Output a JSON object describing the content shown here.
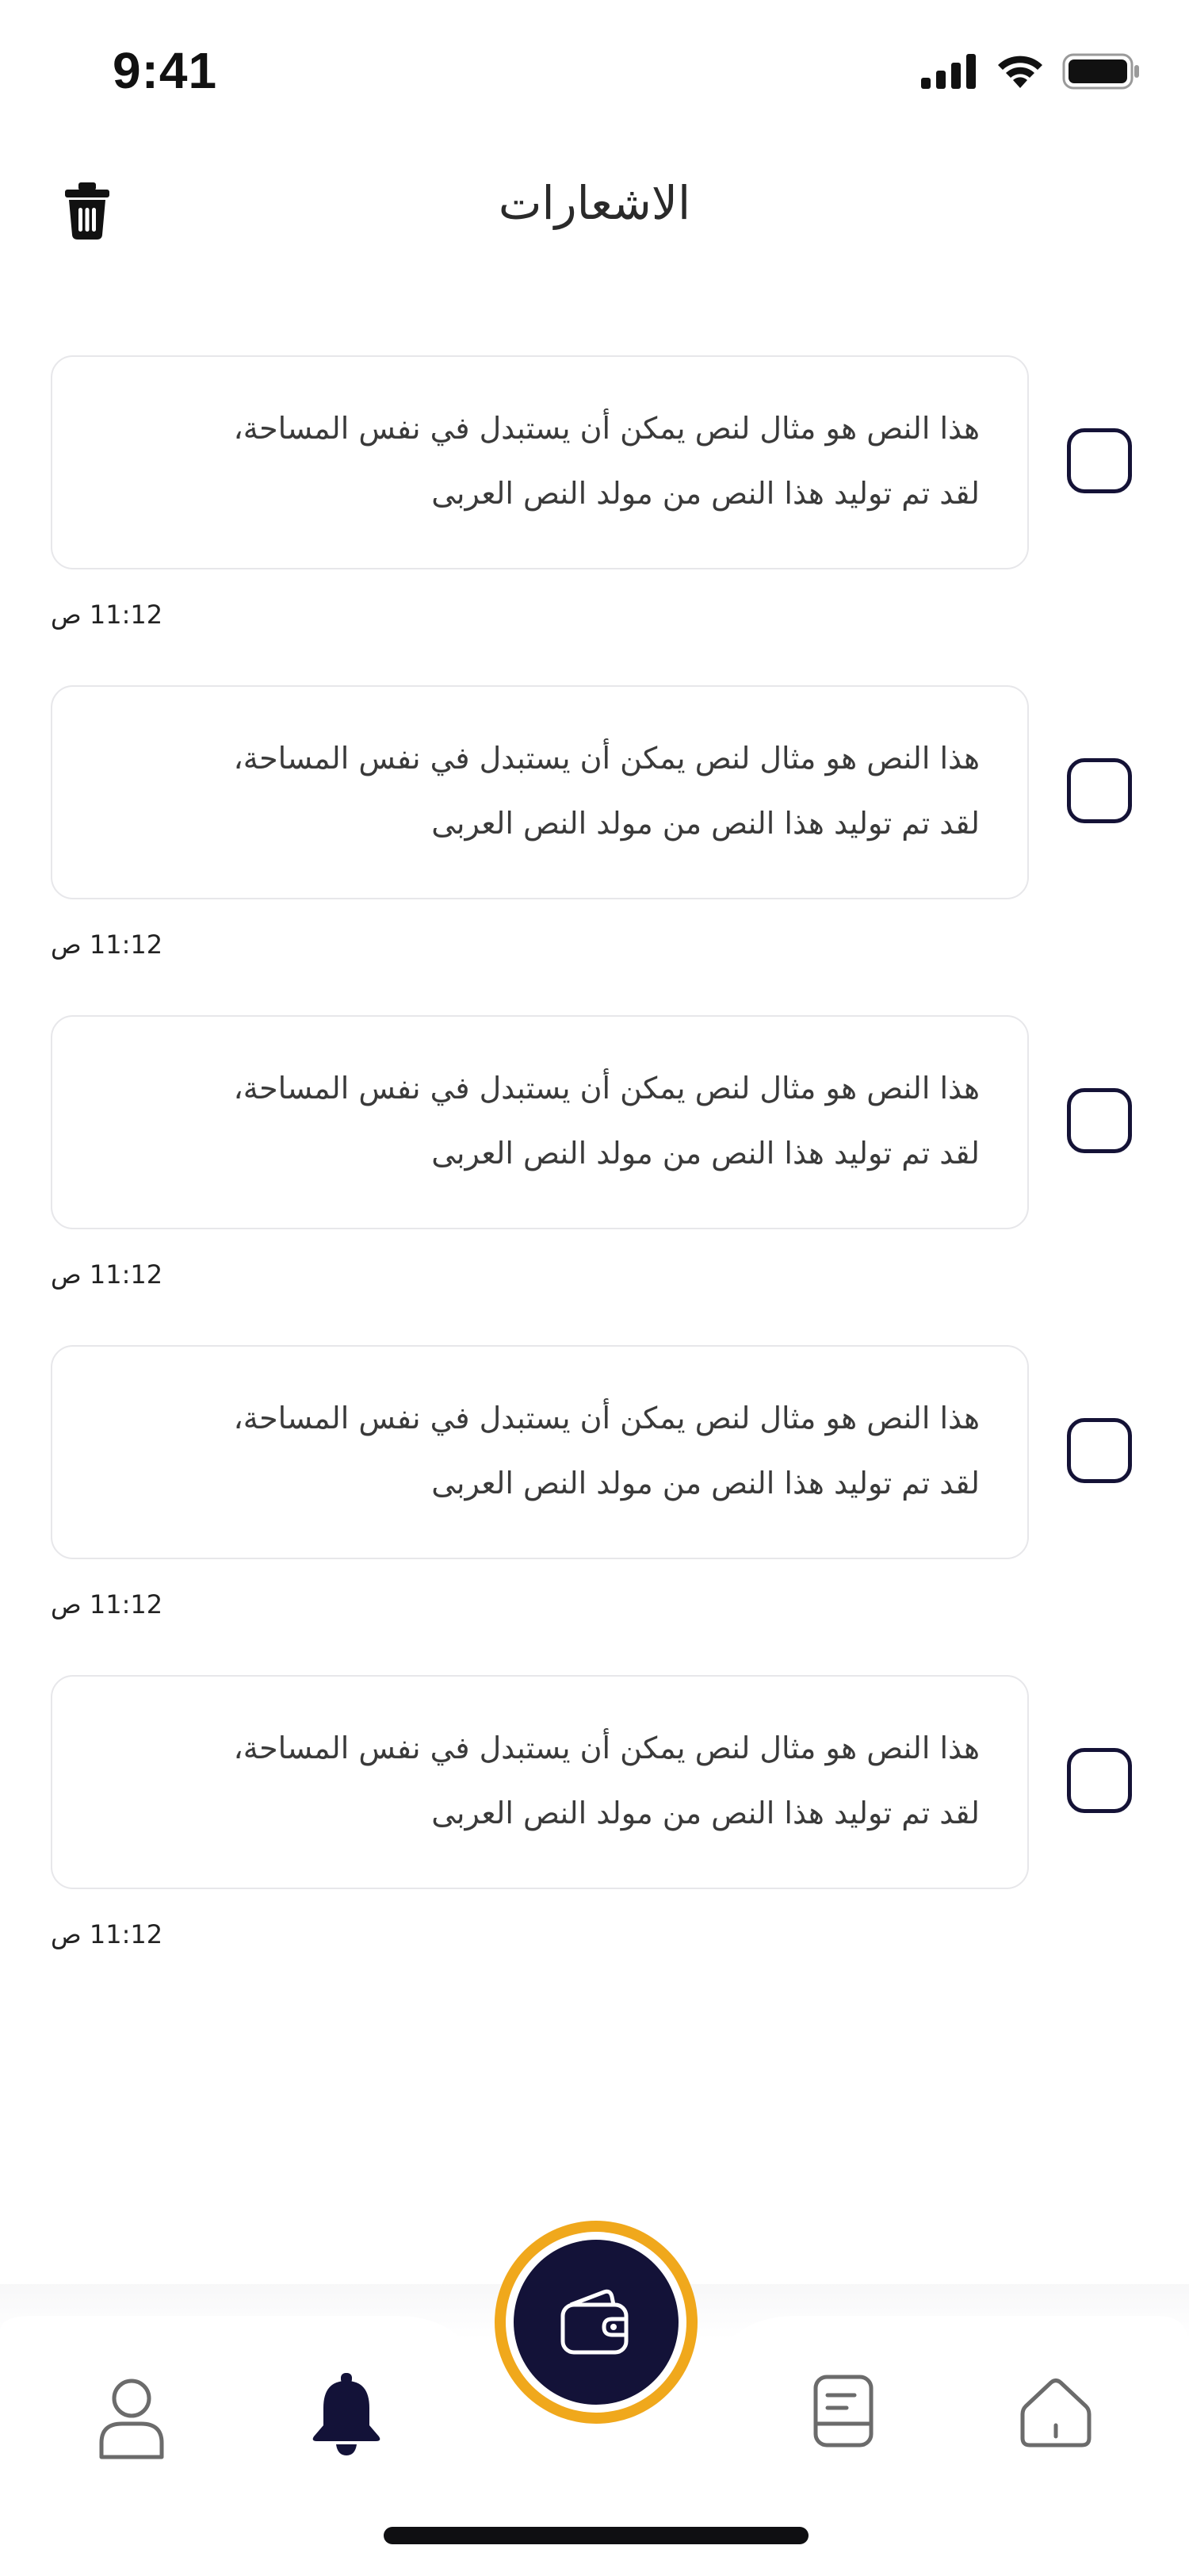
{
  "status_bar": {
    "time": "9:41"
  },
  "header": {
    "title": "الاشعارات"
  },
  "notifications": [
    {
      "line1": "هذا النص هو مثال لنص يمكن أن يستبدل في نفس المساحة،",
      "line2": "لقد تم توليد هذا النص من مولد النص العربى",
      "time": "11:12 ص"
    },
    {
      "line1": "هذا النص هو مثال لنص يمكن أن يستبدل في نفس المساحة،",
      "line2": "لقد تم توليد هذا النص من مولد النص العربى",
      "time": "11:12 ص"
    },
    {
      "line1": "هذا النص هو مثال لنص يمكن أن يستبدل في نفس المساحة،",
      "line2": "لقد تم توليد هذا النص من مولد النص العربى",
      "time": "11:12 ص"
    },
    {
      "line1": "هذا النص هو مثال لنص يمكن أن يستبدل في نفس المساحة،",
      "line2": "لقد تم توليد هذا النص من مولد النص العربى",
      "time": "11:12 ص"
    },
    {
      "line1": "هذا النص هو مثال لنص يمكن أن يستبدل في نفس المساحة،",
      "line2": "لقد تم توليد هذا النص من مولد النص العربى",
      "time": "11:12 ص"
    }
  ],
  "bottom_nav": {
    "items": [
      {
        "icon": "user-icon"
      },
      {
        "icon": "bell-icon",
        "active": true
      },
      {
        "icon": "wallet-icon",
        "center": true
      },
      {
        "icon": "document-icon"
      },
      {
        "icon": "home-icon"
      }
    ]
  },
  "colors": {
    "accent": "#f0a81c",
    "primary": "#131238",
    "icon_gray": "#6b6b6b",
    "card_border": "#e7e7ea"
  }
}
